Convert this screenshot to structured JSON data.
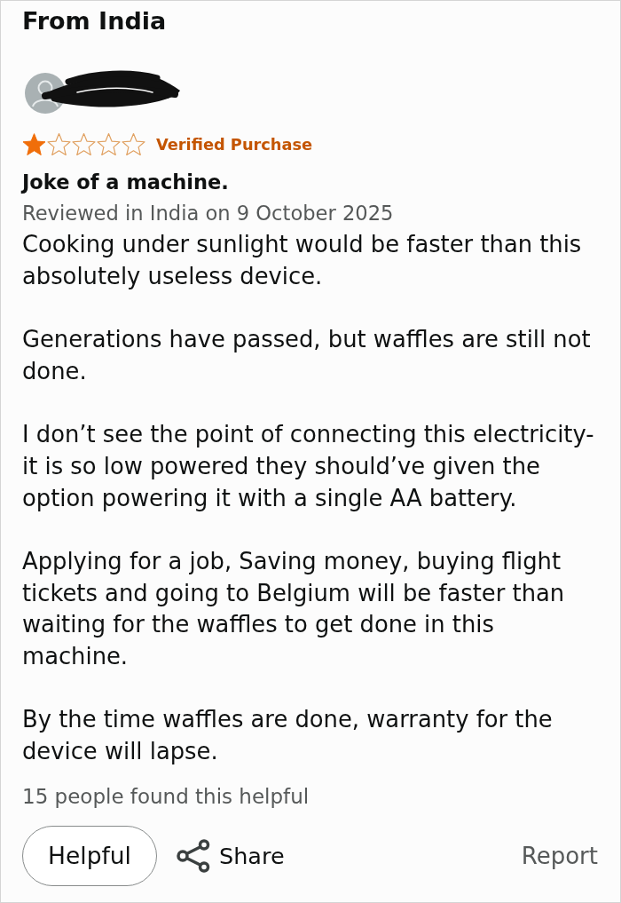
{
  "heading": "From India",
  "review": {
    "stars": 1,
    "badge": "Verified Purchase",
    "title": "Joke of a machine.",
    "meta": "Reviewed in India on 9 October 2025",
    "paragraphs": [
      "Cooking under sunlight would be faster than this absolutely useless device.",
      "Generations have passed, but waffles are still not done.",
      "I don’t see the point of connecting this electricity- it is so low powered they should’ve given the option powering it with a single AA battery.",
      "Applying for a job, Saving money, buying flight tickets and going to Belgium will be faster than waiting for the waffles to get done in this machine.",
      "By the time waffles are done, warranty for the device will lapse."
    ],
    "helpful_count": "15 people found this helpful"
  },
  "actions": {
    "helpful": "Helpful",
    "share": "Share",
    "report": "Report"
  }
}
